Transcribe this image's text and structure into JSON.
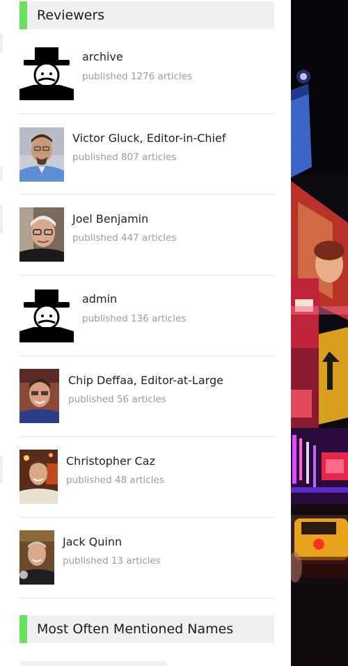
{
  "reviewers_widget": {
    "title": "Reviewers",
    "items": [
      {
        "name": "archive",
        "count_text": "published 1276 articles",
        "avatar": "default-hat-avatar"
      },
      {
        "name": "Victor Gluck, Editor-in-Chief",
        "count_text": "published 807 articles",
        "avatar": "photo-avatar"
      },
      {
        "name": "Joel Benjamin",
        "count_text": "published 447 articles",
        "avatar": "photo-avatar"
      },
      {
        "name": "admin",
        "count_text": "published 136 articles",
        "avatar": "default-hat-avatar"
      },
      {
        "name": "Chip Deffaa, Editor-at-Large",
        "count_text": "published 56 articles",
        "avatar": "photo-avatar"
      },
      {
        "name": "Christopher Caz",
        "count_text": "published 48 articles",
        "avatar": "photo-avatar"
      },
      {
        "name": "Jack Quinn",
        "count_text": "published 13 articles",
        "avatar": "photo-avatar"
      }
    ]
  },
  "names_widget": {
    "title": "Most Often Mentioned Names"
  },
  "colors": {
    "accent": "#66e35a",
    "title_bg": "#f0f0f0",
    "muted_text": "#9b9b9b"
  }
}
